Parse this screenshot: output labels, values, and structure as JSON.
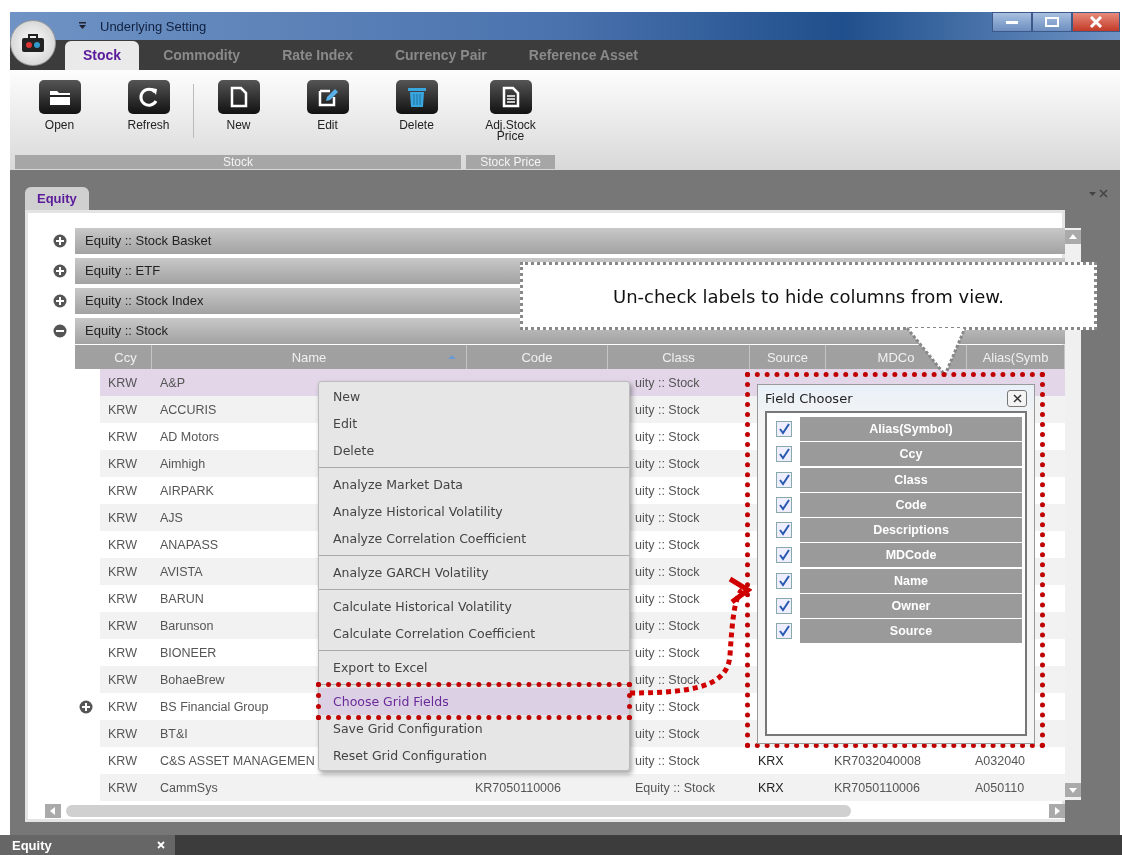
{
  "window": {
    "title": "Underlying Setting"
  },
  "tabs": [
    {
      "label": "Stock",
      "selected": true
    },
    {
      "label": "Commodity",
      "selected": false
    },
    {
      "label": "Rate Index",
      "selected": false
    },
    {
      "label": "Currency Pair",
      "selected": false
    },
    {
      "label": "Reference Asset",
      "selected": false
    }
  ],
  "ribbon": [
    {
      "label": "Stock",
      "buttons": [
        {
          "label": "Open",
          "kind": "folder",
          "separator_before": false
        },
        {
          "label": "Refresh",
          "kind": "refresh",
          "separator_before": false
        },
        {
          "label": "New",
          "kind": "new",
          "separator_before": true
        },
        {
          "label": "Edit",
          "kind": "edit",
          "separator_before": false
        },
        {
          "label": "Delete",
          "kind": "delete",
          "separator_before": false
        }
      ]
    },
    {
      "label": "Stock Price",
      "buttons": [
        {
          "label": "Adj.Stock Price",
          "kind": "document",
          "separator_before": false
        }
      ]
    }
  ],
  "document_tabs": [
    {
      "label": "Equity",
      "selected": true
    }
  ],
  "groups": [
    {
      "label": "Equity :: Stock Basket",
      "expanded": false
    },
    {
      "label": "Equity :: ETF",
      "expanded": false
    },
    {
      "label": "Equity :: Stock Index",
      "expanded": false
    },
    {
      "label": "Equity :: Stock",
      "expanded": true
    }
  ],
  "grid": {
    "columns": [
      {
        "label": "Ccy",
        "sorted": false
      },
      {
        "label": "Name",
        "sorted": true
      },
      {
        "label": "Code",
        "sorted": false
      },
      {
        "label": "Class",
        "sorted": false
      },
      {
        "label": "Source",
        "sorted": false
      },
      {
        "label": "MDCo",
        "sorted": false
      },
      {
        "label": "Alias(Symb",
        "sorted": false
      }
    ],
    "rows": [
      {
        "ccy": "KRW",
        "name": "A&P",
        "class": "uity :: Stock",
        "selected": true,
        "has_children": false
      },
      {
        "ccy": "KRW",
        "name": "ACCURIS",
        "class": "uity :: Stock",
        "selected": false,
        "has_children": false
      },
      {
        "ccy": "KRW",
        "name": "AD Motors",
        "class": "uity :: Stock",
        "selected": false,
        "has_children": false
      },
      {
        "ccy": "KRW",
        "name": "Aimhigh",
        "class": "uity :: Stock",
        "selected": false,
        "has_children": false
      },
      {
        "ccy": "KRW",
        "name": "AIRPARK",
        "class": "uity :: Stock",
        "selected": false,
        "has_children": false
      },
      {
        "ccy": "KRW",
        "name": "AJS",
        "class": "uity :: Stock",
        "selected": false,
        "has_children": false
      },
      {
        "ccy": "KRW",
        "name": "ANAPASS",
        "class": "uity :: Stock",
        "selected": false,
        "has_children": false
      },
      {
        "ccy": "KRW",
        "name": "AVISTA",
        "class": "uity :: Stock",
        "selected": false,
        "has_children": false
      },
      {
        "ccy": "KRW",
        "name": "BARUN",
        "class": "uity :: Stock",
        "selected": false,
        "has_children": false
      },
      {
        "ccy": "KRW",
        "name": "Barunson",
        "class": "uity :: Stock",
        "selected": false,
        "has_children": false
      },
      {
        "ccy": "KRW",
        "name": "BIONEER",
        "class": "uity :: Stock",
        "selected": false,
        "has_children": false
      },
      {
        "ccy": "KRW",
        "name": "BohaeBrew",
        "class": "uity :: Stock",
        "selected": false,
        "has_children": false
      },
      {
        "ccy": "KRW",
        "name": "BS Financial Group",
        "class": "uity :: Stock",
        "selected": false,
        "has_children": true
      },
      {
        "ccy": "KRW",
        "name": "BT&I",
        "class": "uity :: Stock",
        "selected": false,
        "has_children": false
      },
      {
        "ccy": "KRW",
        "name": "C&S ASSET MANAGEMEN",
        "class": "uity :: Stock",
        "source": "KRX",
        "mdcode": "KR7032040008",
        "alias": "A032040",
        "selected": false,
        "has_children": false
      },
      {
        "ccy": "KRW",
        "name": "CammSys",
        "code": "KR7050110006",
        "class": "Equity :: Stock",
        "source": "KRX",
        "mdcode": "KR7050110006",
        "alias": "A050110",
        "selected": false,
        "has_children": false
      }
    ]
  },
  "context_menu": [
    {
      "items": [
        {
          "label": "New",
          "selected": false
        },
        {
          "label": "Edit",
          "selected": false
        },
        {
          "label": "Delete",
          "selected": false
        }
      ]
    },
    {
      "items": [
        {
          "label": "Analyze Market Data",
          "selected": false
        },
        {
          "label": "Analyze Historical Volatility",
          "selected": false
        },
        {
          "label": "Analyze Correlation Coefficient",
          "selected": false
        }
      ]
    },
    {
      "items": [
        {
          "label": "Analyze GARCH Volatility",
          "selected": false
        }
      ]
    },
    {
      "items": [
        {
          "label": "Calculate Historical Volatility",
          "selected": false
        },
        {
          "label": "Calculate Correlation Coefficient",
          "selected": false
        }
      ]
    },
    {
      "items": [
        {
          "label": "Export to Excel",
          "selected": false
        }
      ]
    },
    {
      "items": [
        {
          "label": "Choose Grid Fields",
          "selected": true
        },
        {
          "label": "Save Grid Configuration",
          "selected": false
        },
        {
          "label": "Reset Grid Configuration",
          "selected": false
        }
      ]
    }
  ],
  "field_chooser": {
    "title": "Field Chooser",
    "fields": [
      {
        "label": "Alias(Symbol)",
        "checked": true
      },
      {
        "label": "Ccy",
        "checked": true
      },
      {
        "label": "Class",
        "checked": true
      },
      {
        "label": "Code",
        "checked": true
      },
      {
        "label": "Descriptions",
        "checked": true
      },
      {
        "label": "MDCode",
        "checked": true
      },
      {
        "label": "Name",
        "checked": true
      },
      {
        "label": "Owner",
        "checked": true
      },
      {
        "label": "Source",
        "checked": true
      }
    ]
  },
  "callout": {
    "text": "Un-check labels to hide columns from view."
  },
  "bottom_tabs": [
    {
      "label": "Equity"
    }
  ]
}
